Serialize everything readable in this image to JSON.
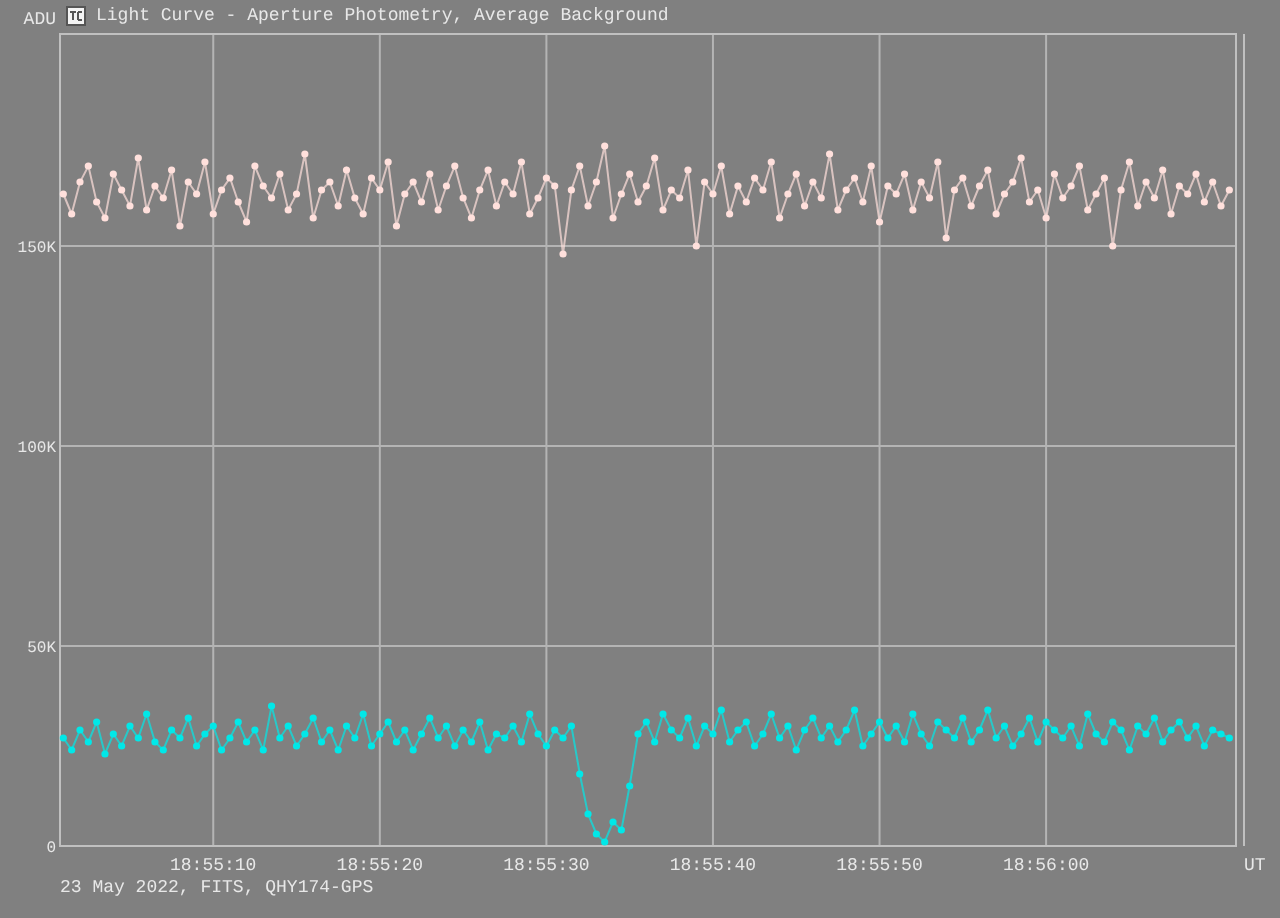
{
  "window": {
    "title": "Light Curve - Aperture Photometry, Average Background"
  },
  "chart_data": {
    "type": "line",
    "xlabel": "UT",
    "ylabel": "ADU",
    "xlim": [
      68100.8,
      68171.4
    ],
    "ylim": [
      0,
      203
    ],
    "grid": true,
    "xticks": [
      {
        "value": 68110,
        "label": "18:55:10"
      },
      {
        "value": 68120,
        "label": "18:55:20"
      },
      {
        "value": 68130,
        "label": "18:55:30"
      },
      {
        "value": 68140,
        "label": "18:55:40"
      },
      {
        "value": 68150,
        "label": "18:55:50"
      },
      {
        "value": 68160,
        "label": "18:56:00"
      }
    ],
    "yticks": [
      {
        "value": 0,
        "label": "0"
      },
      {
        "value": 50,
        "label": "50K"
      },
      {
        "value": 100,
        "label": "100K"
      },
      {
        "value": 150,
        "label": "150K"
      }
    ],
    "x": [
      68101,
      68101.5,
      68102,
      68102.5,
      68103,
      68103.5,
      68104,
      68104.5,
      68105,
      68105.5,
      68106,
      68106.5,
      68107,
      68107.5,
      68108,
      68108.5,
      68109,
      68109.5,
      68110,
      68110.5,
      68111,
      68111.5,
      68112,
      68112.5,
      68113,
      68113.5,
      68114,
      68114.5,
      68115,
      68115.5,
      68116,
      68116.5,
      68117,
      68117.5,
      68118,
      68118.5,
      68119,
      68119.5,
      68120,
      68120.5,
      68121,
      68121.5,
      68122,
      68122.5,
      68123,
      68123.5,
      68124,
      68124.5,
      68125,
      68125.5,
      68126,
      68126.5,
      68127,
      68127.5,
      68128,
      68128.5,
      68129,
      68129.5,
      68130,
      68130.5,
      68131,
      68131.5,
      68132,
      68132.5,
      68133,
      68133.5,
      68134,
      68134.5,
      68135,
      68135.5,
      68136,
      68136.5,
      68137,
      68137.5,
      68138,
      68138.5,
      68139,
      68139.5,
      68140,
      68140.5,
      68141,
      68141.5,
      68142,
      68142.5,
      68143,
      68143.5,
      68144,
      68144.5,
      68145,
      68145.5,
      68146,
      68146.5,
      68147,
      68147.5,
      68148,
      68148.5,
      68149,
      68149.5,
      68150,
      68150.5,
      68151,
      68151.5,
      68152,
      68152.5,
      68153,
      68153.5,
      68154,
      68154.5,
      68155,
      68155.5,
      68156,
      68156.5,
      68157,
      68157.5,
      68158,
      68158.5,
      68159,
      68159.5,
      68160,
      68160.5,
      68161,
      68161.5,
      68162,
      68162.5,
      68163,
      68163.5,
      68164,
      68164.5,
      68165,
      68165.5,
      68166,
      68166.5,
      68167,
      68167.5,
      68168,
      68168.5,
      68169,
      68169.5,
      68170,
      68170.5,
      68171
    ],
    "series": [
      {
        "color": "#ffe0dc",
        "marker": "circle",
        "values": [
          163,
          158,
          166,
          170,
          161,
          157,
          168,
          164,
          160,
          172,
          159,
          165,
          162,
          169,
          155,
          166,
          163,
          171,
          158,
          164,
          167,
          161,
          156,
          170,
          165,
          162,
          168,
          159,
          163,
          173,
          157,
          164,
          166,
          160,
          169,
          162,
          158,
          167,
          164,
          171,
          155,
          163,
          166,
          161,
          168,
          159,
          165,
          170,
          162,
          157,
          164,
          169,
          160,
          166,
          163,
          171,
          158,
          162,
          167,
          165,
          148,
          164,
          170,
          160,
          166,
          175,
          157,
          163,
          168,
          161,
          165,
          172,
          159,
          164,
          162,
          169,
          150,
          166,
          163,
          170,
          158,
          165,
          161,
          167,
          164,
          171,
          157,
          163,
          168,
          160,
          166,
          162,
          173,
          159,
          164,
          167,
          161,
          170,
          156,
          165,
          163,
          168,
          159,
          166,
          162,
          171,
          152,
          164,
          167,
          160,
          165,
          169,
          158,
          163,
          166,
          172,
          161,
          164,
          157,
          168,
          162,
          165,
          170,
          159,
          163,
          167,
          150,
          164,
          171,
          160,
          166,
          162,
          169,
          158,
          165,
          163,
          168,
          161,
          166,
          160,
          164
        ]
      },
      {
        "color": "#00e8e8",
        "marker": "circle",
        "values": [
          27,
          24,
          29,
          26,
          31,
          23,
          28,
          25,
          30,
          27,
          33,
          26,
          24,
          29,
          27,
          32,
          25,
          28,
          30,
          24,
          27,
          31,
          26,
          29,
          24,
          35,
          27,
          30,
          25,
          28,
          32,
          26,
          29,
          24,
          30,
          27,
          33,
          25,
          28,
          31,
          26,
          29,
          24,
          28,
          32,
          27,
          30,
          25,
          29,
          26,
          31,
          24,
          28,
          27,
          30,
          26,
          33,
          28,
          25,
          29,
          27,
          30,
          18,
          8,
          3,
          1,
          6,
          4,
          15,
          28,
          31,
          26,
          33,
          29,
          27,
          32,
          25,
          30,
          28,
          34,
          26,
          29,
          31,
          25,
          28,
          33,
          27,
          30,
          24,
          29,
          32,
          27,
          30,
          26,
          29,
          34,
          25,
          28,
          31,
          27,
          30,
          26,
          33,
          28,
          25,
          31,
          29,
          27,
          32,
          26,
          29,
          34,
          27,
          30,
          25,
          28,
          32,
          26,
          31,
          29,
          27,
          30,
          25,
          33,
          28,
          26,
          31,
          29,
          24,
          30,
          28,
          32,
          26,
          29,
          31,
          27,
          30,
          25,
          29,
          28,
          27
        ]
      }
    ]
  },
  "footer": "23 May 2022, FITS, QHY174-GPS"
}
